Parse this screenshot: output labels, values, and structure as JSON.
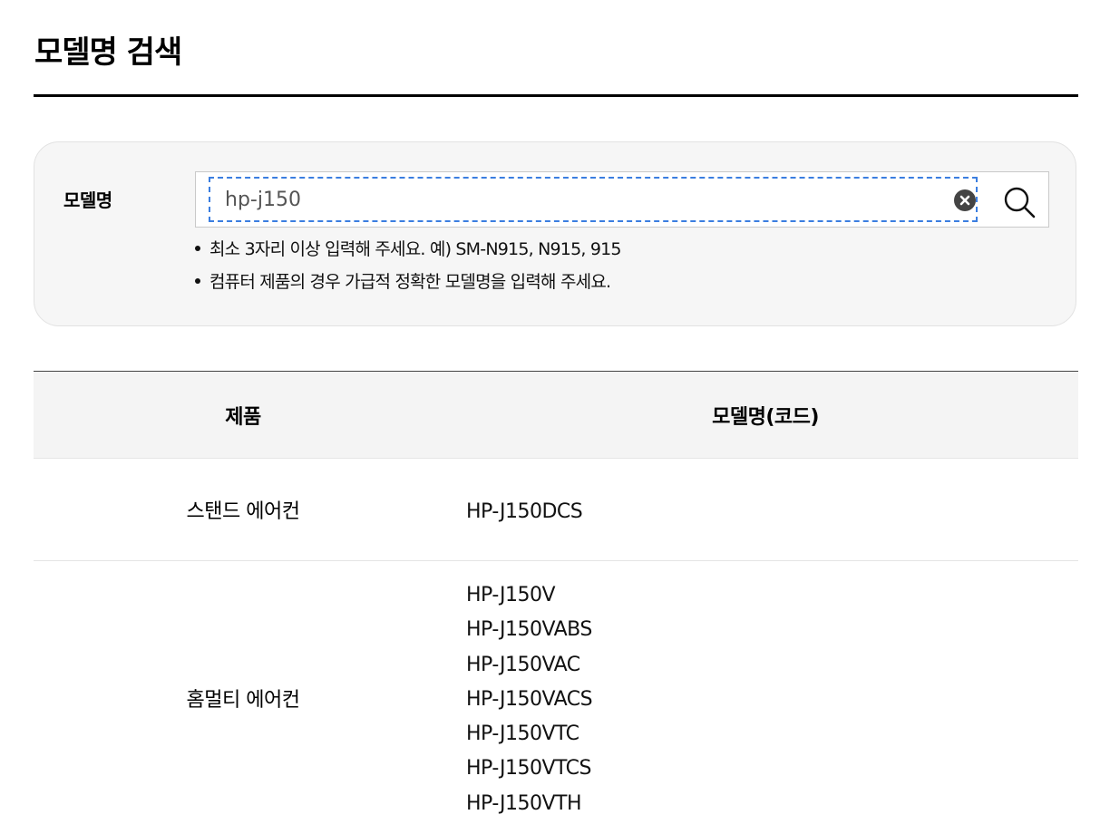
{
  "page": {
    "title": "모델명 검색"
  },
  "search": {
    "label": "모델명",
    "value": "hp-j150",
    "hints": [
      "최소 3자리 이상 입력해 주세요. 예) SM-N915, N915, 915",
      "컴퓨터 제품의 경우 가급적 정확한 모델명을 입력해 주세요."
    ]
  },
  "table": {
    "headers": {
      "product": "제품",
      "model": "모델명(코드)"
    },
    "rows": [
      {
        "product": "스탠드 에어컨",
        "models": [
          "HP-J150DCS"
        ]
      },
      {
        "product": "홈멀티 에어컨",
        "models": [
          "HP-J150V",
          "HP-J150VABS",
          "HP-J150VAC",
          "HP-J150VACS",
          "HP-J150VTC",
          "HP-J150VTCS",
          "HP-J150VTH"
        ]
      }
    ]
  }
}
